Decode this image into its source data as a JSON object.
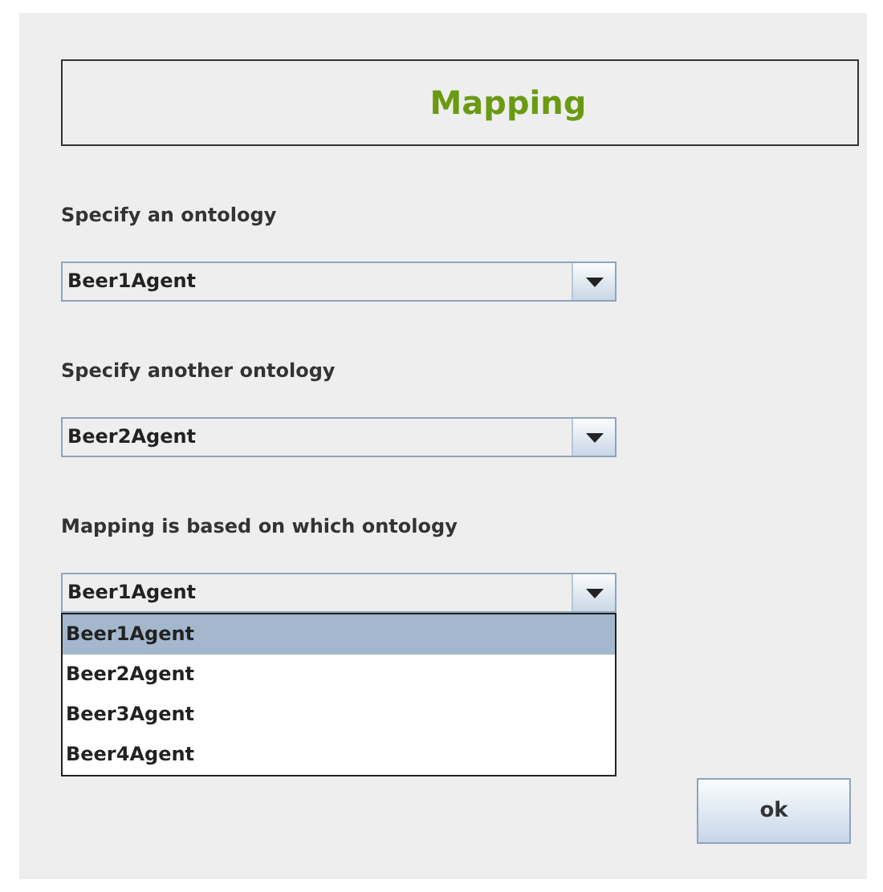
{
  "title": "Mapping",
  "fields": [
    {
      "label": "Specify an ontology",
      "value": "Beer1Agent"
    },
    {
      "label": "Specify another ontology",
      "value": "Beer2Agent"
    },
    {
      "label": "Mapping is based on which ontology",
      "value": "Beer1Agent",
      "expanded": true,
      "options": [
        {
          "label": "Beer1Agent",
          "selected": true
        },
        {
          "label": "Beer2Agent",
          "selected": false
        },
        {
          "label": "Beer3Agent",
          "selected": false
        },
        {
          "label": "Beer4Agent",
          "selected": false
        }
      ]
    }
  ],
  "buttons": [
    "ok"
  ]
}
